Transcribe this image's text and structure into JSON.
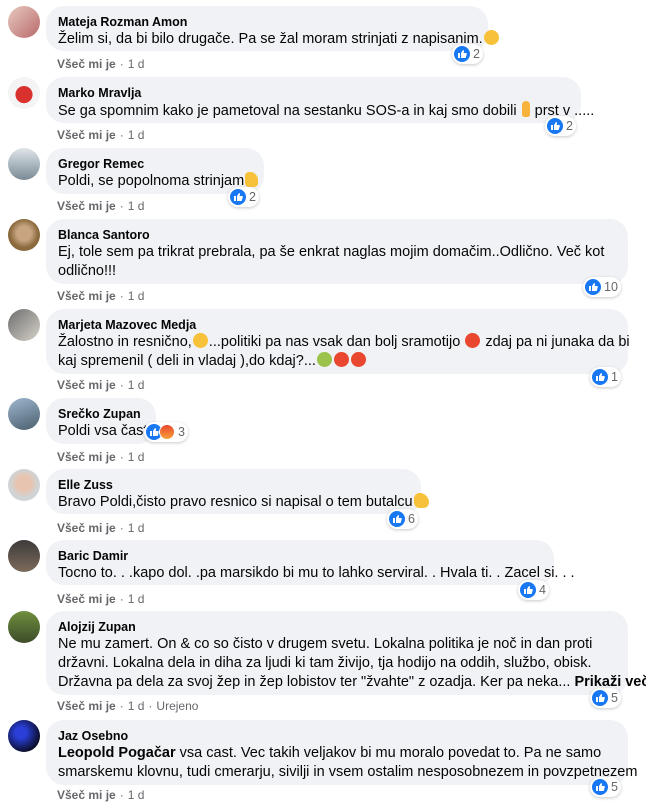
{
  "comments": [
    {
      "author": "Mateja Rozman Amon",
      "lines": [
        "Želim si, da bi bilo drugače. Pa se žal moram strinjati z napisanim."
      ],
      "reactions": "2",
      "like_label": "Všeč mi je",
      "time": "1 d"
    },
    {
      "author": "Marko Mravlja",
      "lines": [
        "Se ga spomnim kako je pametoval na sestanku SOS-a in kaj smo dobili",
        "prst v ....."
      ],
      "reactions": "2",
      "like_label": "Všeč mi je",
      "time": "1 d"
    },
    {
      "author": "Gregor Remec",
      "lines": [
        "Poldi, se popolnoma strinjam"
      ],
      "reactions": "2",
      "like_label": "Všeč mi je",
      "time": "1 d"
    },
    {
      "author": "Blanca Santoro",
      "lines": [
        "Ej, tole sem pa trikrat prebrala, pa še enkrat naglas mojim domačim..Odlično. Več kot",
        "odlično!!!"
      ],
      "reactions": "10",
      "like_label": "Všeč mi je",
      "time": "1 d"
    },
    {
      "author": "Marjeta Mazovec Medja",
      "lines": [
        "Žalostno in resnično,",
        "...politiki pa nas vsak dan bolj sramotijo",
        "zdaj pa ni junaka da bi",
        "kaj spremenil ( deli in vladaj ),do kdaj?..."
      ],
      "reactions": "1",
      "like_label": "Všeč mi je",
      "time": "1 d"
    },
    {
      "author": "Srečko Zupan",
      "lines": [
        "Poldi vsa čast!"
      ],
      "reactions": "3",
      "like_label": "Všeč mi je",
      "time": "1 d"
    },
    {
      "author": "Elle Zuss",
      "lines": [
        "Bravo Poldi,čisto pravo resnico si napisal o tem butalcu"
      ],
      "reactions": "6",
      "like_label": "Všeč mi je",
      "time": "1 d"
    },
    {
      "author": "Baric Damir",
      "lines": [
        "Tocno to. . .kapo dol. .pa marsikdo bi mu to lahko serviral. . Hvala ti. . Zacel si. . ."
      ],
      "reactions": "4",
      "like_label": "Všeč mi je",
      "time": "1 d"
    },
    {
      "author": "Alojzij Zupan",
      "lines": [
        "Ne mu zamert. On & co so čisto v drugem svetu. Lokalna politika je noč in dan proti",
        "državni. Lokalna dela in diha za ljudi ki tam živijo, tja hodijo na oddih, službo, obisk.",
        "Državna pa dela za svoj žep in žep lobistov ter \"žvahte\" z ozadja. Ker pa neka..."
      ],
      "see_more": "Prikaži več",
      "reactions": "5",
      "like_label": "Všeč mi je",
      "time": "1 d",
      "edited": "Urejeno"
    },
    {
      "author": "Jaz Osebno",
      "mention": "Leopold Pogačar",
      "lines": [
        " vsa cast. Vec takih veljakov bi mu moralo povedat to. Pa ne samo",
        "smarskemu klovnu, tudi cmerarju, sivilji in vsem ostalim nesposobnezem in povzpetnezem"
      ],
      "reactions": "5",
      "like_label": "Všeč mi je",
      "time": "1 d"
    }
  ],
  "colors": {
    "bubble": "#f0f2f5",
    "like_blue": "#1877f2",
    "meta_gray": "#65676b"
  }
}
